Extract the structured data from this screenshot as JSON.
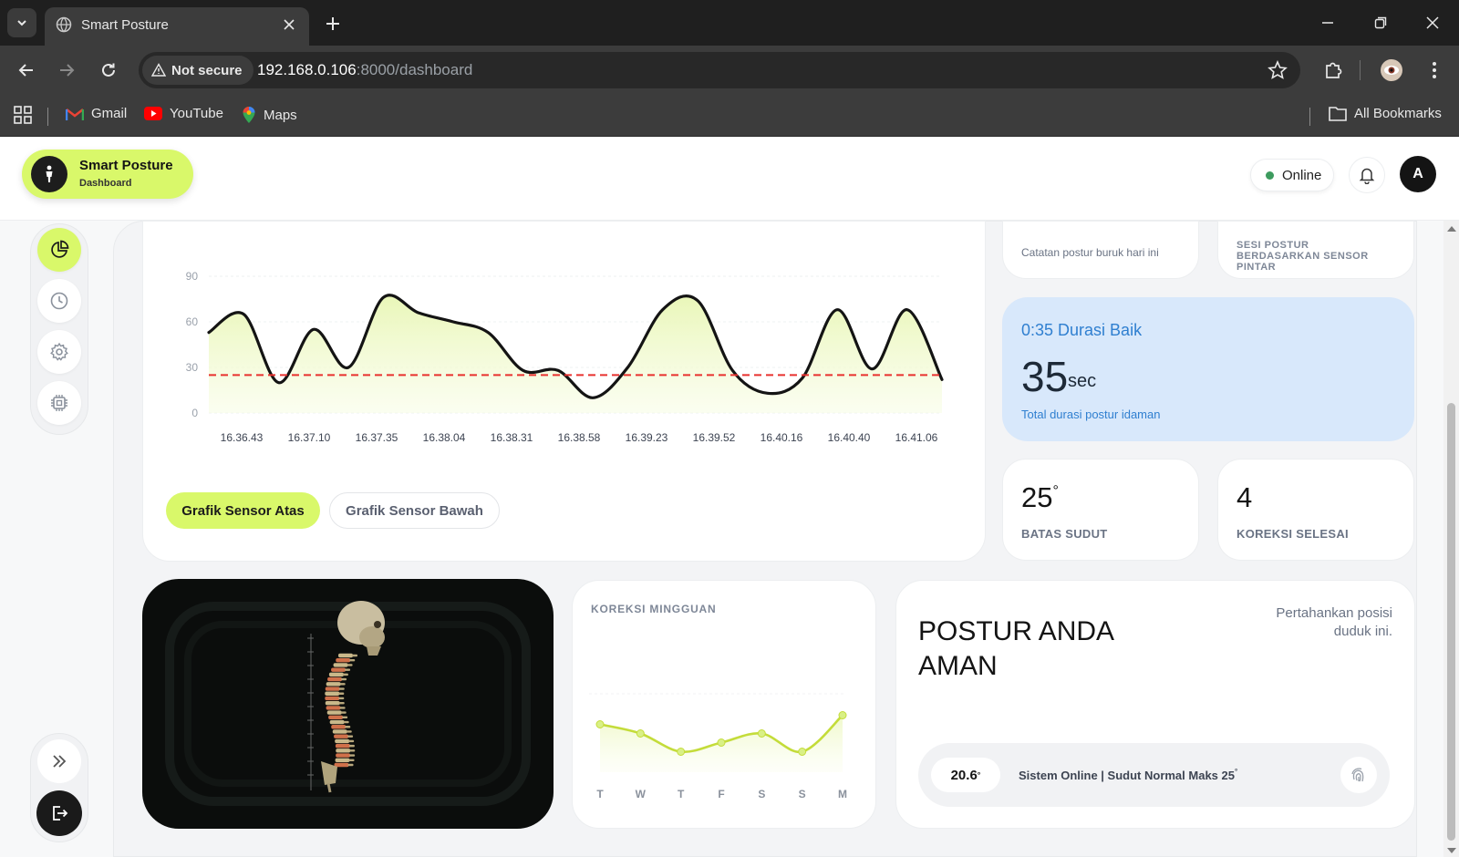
{
  "browser": {
    "tab_title": "Smart Posture",
    "security_label": "Not secure",
    "url_host": "192.168.0.106",
    "url_rest": ":8000/dashboard",
    "bookmarks": [
      "Gmail",
      "YouTube",
      "Maps"
    ],
    "all_bookmarks": "All Bookmarks"
  },
  "header": {
    "brand_title": "Smart Posture",
    "brand_subtitle": "Dashboard",
    "status": "Online",
    "avatar_initial": "A"
  },
  "sidenav": {
    "items": [
      "chart-pie-icon",
      "clock-icon",
      "gear-icon",
      "chip-icon"
    ],
    "active": 0
  },
  "chart_data": [
    {
      "type": "line",
      "x": [
        "16.36.43",
        "16.37.10",
        "16.37.35",
        "16.38.04",
        "16.38.31",
        "16.38.58",
        "16.39.23",
        "16.39.52",
        "16.40.16",
        "16.40.40",
        "16.41.06"
      ],
      "series": [
        {
          "values": [
            53,
            65,
            20,
            55,
            30,
            76,
            66,
            60,
            53,
            28,
            28,
            10,
            30,
            68,
            74,
            28,
            13,
            23,
            68,
            29,
            68,
            22
          ]
        }
      ],
      "threshold": 25,
      "threshold_color": "#e8312f",
      "ylim": [
        0,
        90
      ],
      "yticks": [
        0,
        30,
        60,
        90
      ],
      "grid": true,
      "tabs": [
        "Grafik Sensor Atas",
        "Grafik Sensor Bawah"
      ],
      "active_tab": 0
    },
    {
      "type": "line",
      "title": "KOREKSI MINGGUAN",
      "categories": [
        "T",
        "W",
        "T",
        "F",
        "S",
        "S",
        "M"
      ],
      "series": [
        {
          "values": [
            4.2,
            3.4,
            1.8,
            2.6,
            3.4,
            1.8,
            5.0
          ]
        }
      ],
      "ylim": [
        0,
        8
      ],
      "color": "#c4dc3a"
    }
  ],
  "stats": {
    "bad_today_caption": "Catatan postur buruk hari ini",
    "session_caption": "SESI POSTUR BERDASARKAN SENSOR PINTAR",
    "good_duration_title": "0:35 Durasi Baik",
    "good_duration_value": "35",
    "good_duration_unit": "sec",
    "good_duration_caption": "Total durasi postur idaman",
    "angle_limit_value": "25",
    "angle_limit_label": "BATAS SUDUT",
    "corrections_value": "4",
    "corrections_label": "KOREKSI SELESAI"
  },
  "posture": {
    "title": "POSTUR ANDA AMAN",
    "hint": "Pertahankan posisi duduk ini.",
    "current_angle": "20.6",
    "status_text": "Sistem Online | Sudut Normal Maks 25"
  },
  "colors": {
    "accent": "#d9f86a",
    "info_bg": "#d8e8fb",
    "info_text": "#2f7fd0",
    "dark": "#141414"
  }
}
